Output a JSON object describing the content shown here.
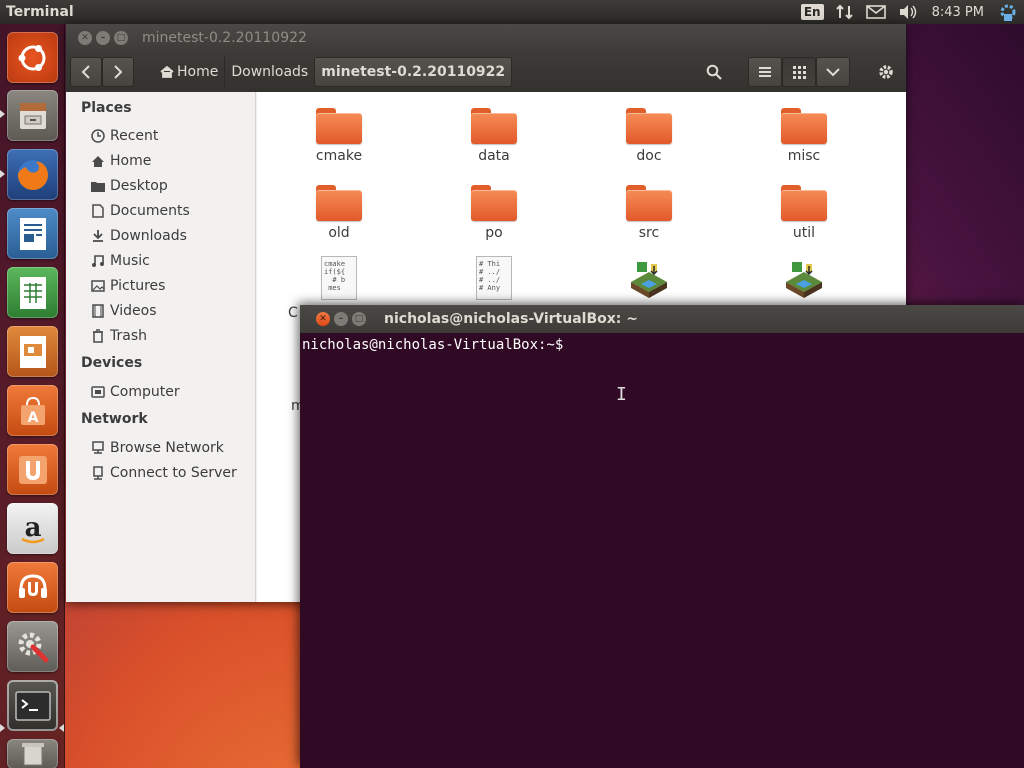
{
  "top_panel": {
    "app_title": "Terminal",
    "keyboard_layout": "En",
    "clock": "8:43 PM"
  },
  "launcher": {
    "items": [
      "dash-home",
      "files",
      "firefox",
      "libreoffice-writer",
      "libreoffice-calc",
      "libreoffice-impress",
      "ubuntu-software-center",
      "ubuntu-one",
      "amazon",
      "ubuntu-one-music",
      "system-settings",
      "terminal",
      "trash"
    ]
  },
  "files": {
    "window_title": "minetest-0.2.20110922",
    "breadcrumb": [
      "Home",
      "Downloads",
      "minetest-0.2.20110922"
    ],
    "sidebar": {
      "places_header": "Places",
      "places": [
        {
          "label": "Recent",
          "icon": "clock-icon"
        },
        {
          "label": "Home",
          "icon": "home-icon"
        },
        {
          "label": "Desktop",
          "icon": "desktop-folder-icon"
        },
        {
          "label": "Documents",
          "icon": "document-icon"
        },
        {
          "label": "Downloads",
          "icon": "download-icon"
        },
        {
          "label": "Music",
          "icon": "music-icon"
        },
        {
          "label": "Pictures",
          "icon": "picture-icon"
        },
        {
          "label": "Videos",
          "icon": "video-icon"
        },
        {
          "label": "Trash",
          "icon": "trash-icon"
        }
      ],
      "devices_header": "Devices",
      "devices": [
        {
          "label": "Computer",
          "icon": "computer-icon"
        }
      ],
      "network_header": "Network",
      "network": [
        {
          "label": "Browse Network",
          "icon": "network-icon"
        },
        {
          "label": "Connect to Server",
          "icon": "server-icon"
        }
      ]
    },
    "items": [
      {
        "label": "cmake",
        "type": "folder"
      },
      {
        "label": "data",
        "type": "folder"
      },
      {
        "label": "doc",
        "type": "folder"
      },
      {
        "label": "misc",
        "type": "folder"
      },
      {
        "label": "old",
        "type": "folder"
      },
      {
        "label": "po",
        "type": "folder"
      },
      {
        "label": "src",
        "type": "folder"
      },
      {
        "label": "util",
        "type": "folder"
      }
    ],
    "partial_label_c": "C",
    "partial_label_m": "m",
    "file_previews": [
      "cmake\nif(${\n  # b\n mes",
      "# Thi\n# ../\n# ../\n# Any"
    ]
  },
  "terminal": {
    "window_title": "nicholas@nicholas-VirtualBox: ~",
    "prompt": "nicholas@nicholas-VirtualBox:~$"
  }
}
